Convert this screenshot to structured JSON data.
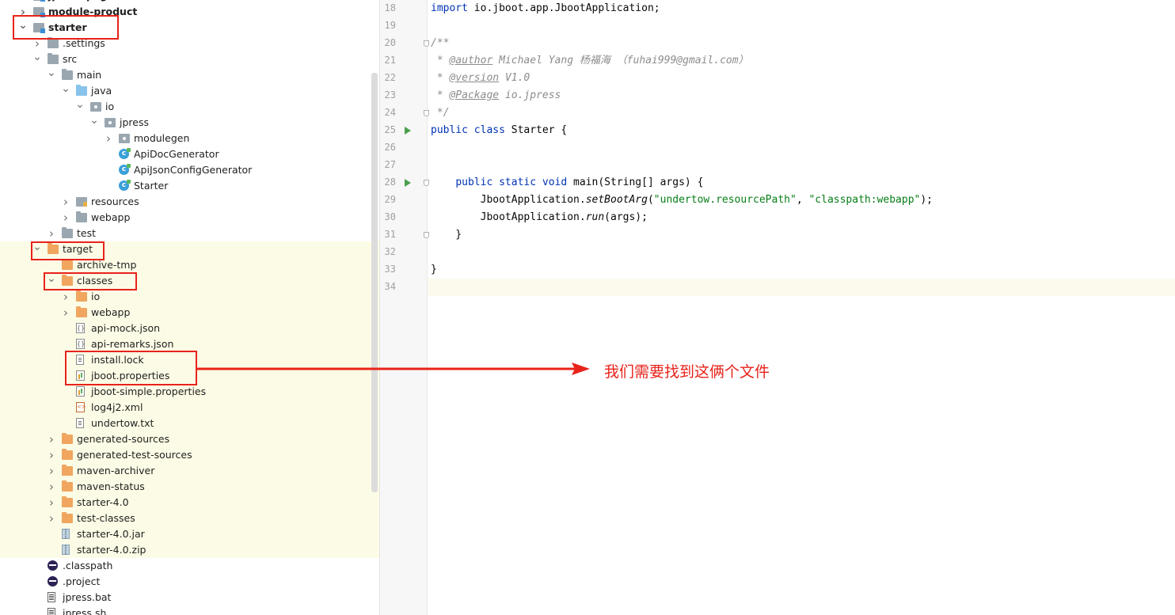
{
  "tree": {
    "rows": [
      {
        "label": "jpress-page",
        "depth": 1,
        "arrow": ">",
        "icon": "module",
        "hl": false,
        "bold": true
      },
      {
        "label": "module-product",
        "depth": 1,
        "arrow": ">",
        "icon": "module",
        "hl": false,
        "bold": true
      },
      {
        "label": "starter",
        "depth": 1,
        "arrow": "v",
        "icon": "module",
        "hl": false,
        "bold": true
      },
      {
        "label": ".settings",
        "depth": 2,
        "arrow": ">",
        "icon": "fold-gray",
        "hl": false
      },
      {
        "label": "src",
        "depth": 2,
        "arrow": "v",
        "icon": "fold-gray",
        "hl": false
      },
      {
        "label": "main",
        "depth": 3,
        "arrow": "v",
        "icon": "fold-gray",
        "hl": false
      },
      {
        "label": "java",
        "depth": 4,
        "arrow": "v",
        "icon": "fold-blue",
        "hl": false
      },
      {
        "label": "io",
        "depth": 5,
        "arrow": "v",
        "icon": "pkg",
        "hl": false
      },
      {
        "label": "jpress",
        "depth": 6,
        "arrow": "v",
        "icon": "pkg",
        "hl": false
      },
      {
        "label": "modulegen",
        "depth": 7,
        "arrow": ">",
        "icon": "pkg",
        "hl": false
      },
      {
        "label": "ApiDocGenerator",
        "depth": 7,
        "arrow": "",
        "icon": "cls",
        "hl": false
      },
      {
        "label": "ApiJsonConfigGenerator",
        "depth": 7,
        "arrow": "",
        "icon": "cls",
        "hl": false
      },
      {
        "label": "Starter",
        "depth": 7,
        "arrow": "",
        "icon": "cls",
        "hl": false
      },
      {
        "label": "resources",
        "depth": 4,
        "arrow": ">",
        "icon": "res",
        "hl": false
      },
      {
        "label": "webapp",
        "depth": 4,
        "arrow": ">",
        "icon": "fold-gray",
        "hl": false
      },
      {
        "label": "test",
        "depth": 3,
        "arrow": ">",
        "icon": "fold-gray",
        "hl": false
      },
      {
        "label": "target",
        "depth": 2,
        "arrow": "v",
        "icon": "fold-orange",
        "hl": true
      },
      {
        "label": "archive-tmp",
        "depth": 3,
        "arrow": "",
        "icon": "fold-orange",
        "hl": true
      },
      {
        "label": "classes",
        "depth": 3,
        "arrow": "v",
        "icon": "fold-orange",
        "hl": true
      },
      {
        "label": "io",
        "depth": 4,
        "arrow": ">",
        "icon": "fold-orange",
        "hl": true
      },
      {
        "label": "webapp",
        "depth": 4,
        "arrow": ">",
        "icon": "fold-orange",
        "hl": true
      },
      {
        "label": "api-mock.json",
        "depth": 4,
        "arrow": "",
        "icon": "json",
        "hl": true
      },
      {
        "label": "api-remarks.json",
        "depth": 4,
        "arrow": "",
        "icon": "json",
        "hl": true
      },
      {
        "label": "install.lock",
        "depth": 4,
        "arrow": "",
        "icon": "file",
        "hl": true
      },
      {
        "label": "jboot.properties",
        "depth": 4,
        "arrow": "",
        "icon": "props",
        "hl": true
      },
      {
        "label": "jboot-simple.properties",
        "depth": 4,
        "arrow": "",
        "icon": "props",
        "hl": true
      },
      {
        "label": "log4j2.xml",
        "depth": 4,
        "arrow": "",
        "icon": "xml",
        "hl": true
      },
      {
        "label": "undertow.txt",
        "depth": 4,
        "arrow": "",
        "icon": "file",
        "hl": true
      },
      {
        "label": "generated-sources",
        "depth": 3,
        "arrow": ">",
        "icon": "fold-orange",
        "hl": true
      },
      {
        "label": "generated-test-sources",
        "depth": 3,
        "arrow": ">",
        "icon": "fold-orange",
        "hl": true
      },
      {
        "label": "maven-archiver",
        "depth": 3,
        "arrow": ">",
        "icon": "fold-orange",
        "hl": true
      },
      {
        "label": "maven-status",
        "depth": 3,
        "arrow": ">",
        "icon": "fold-orange",
        "hl": true
      },
      {
        "label": "starter-4.0",
        "depth": 3,
        "arrow": ">",
        "icon": "fold-orange",
        "hl": true
      },
      {
        "label": "test-classes",
        "depth": 3,
        "arrow": ">",
        "icon": "fold-orange",
        "hl": true
      },
      {
        "label": "starter-4.0.jar",
        "depth": 3,
        "arrow": "",
        "icon": "archive",
        "hl": true
      },
      {
        "label": "starter-4.0.zip",
        "depth": 3,
        "arrow": "",
        "icon": "archive",
        "hl": true
      },
      {
        "label": ".classpath",
        "depth": 2,
        "arrow": "",
        "icon": "eclipse",
        "hl": false
      },
      {
        "label": ".project",
        "depth": 2,
        "arrow": "",
        "icon": "eclipse",
        "hl": false
      },
      {
        "label": "jpress.bat",
        "depth": 2,
        "arrow": "",
        "icon": "bat",
        "hl": false
      },
      {
        "label": "jpress.sh",
        "depth": 2,
        "arrow": "",
        "icon": "bat",
        "hl": false
      }
    ]
  },
  "editor": {
    "line_numbers": [
      "18",
      "19",
      "20",
      "21",
      "22",
      "23",
      "24",
      "25",
      "26",
      "27",
      "28",
      "29",
      "30",
      "31",
      "32",
      "33",
      "34"
    ],
    "code": {
      "l18": {
        "kw": "import",
        "rest": " io.jboot.app.JbootApplication;"
      },
      "l20": "/**",
      "l21": {
        "star": " * ",
        "tag": "@author",
        "text": " Michael Yang 杨福海 （fuhai999@gmail.com）"
      },
      "l22": {
        "star": " * ",
        "tag": "@version",
        "text": " V1.0"
      },
      "l23": {
        "star": " * ",
        "tag": "@Package",
        "text": " io.jpress"
      },
      "l24": " */",
      "l25": {
        "kw": "public class",
        "rest": " Starter {"
      },
      "l28": {
        "indent": "    ",
        "kw": "public static void",
        "rest": " main(String[] args) {"
      },
      "l29": {
        "indent": "        ",
        "obj": "JbootApplication.",
        "method": "setBootArg",
        "open": "(",
        "s1": "\"undertow.resourcePath\"",
        "comma": ", ",
        "s2": "\"classpath:webapp\"",
        "close": ");"
      },
      "l30": {
        "indent": "        ",
        "obj": "JbootApplication.",
        "method": "run",
        "rest": "(args);"
      },
      "l31": "    }",
      "l33": "}"
    }
  },
  "annotation": {
    "text": "我们需要找到这俩个文件",
    "color": "#e8231a"
  }
}
